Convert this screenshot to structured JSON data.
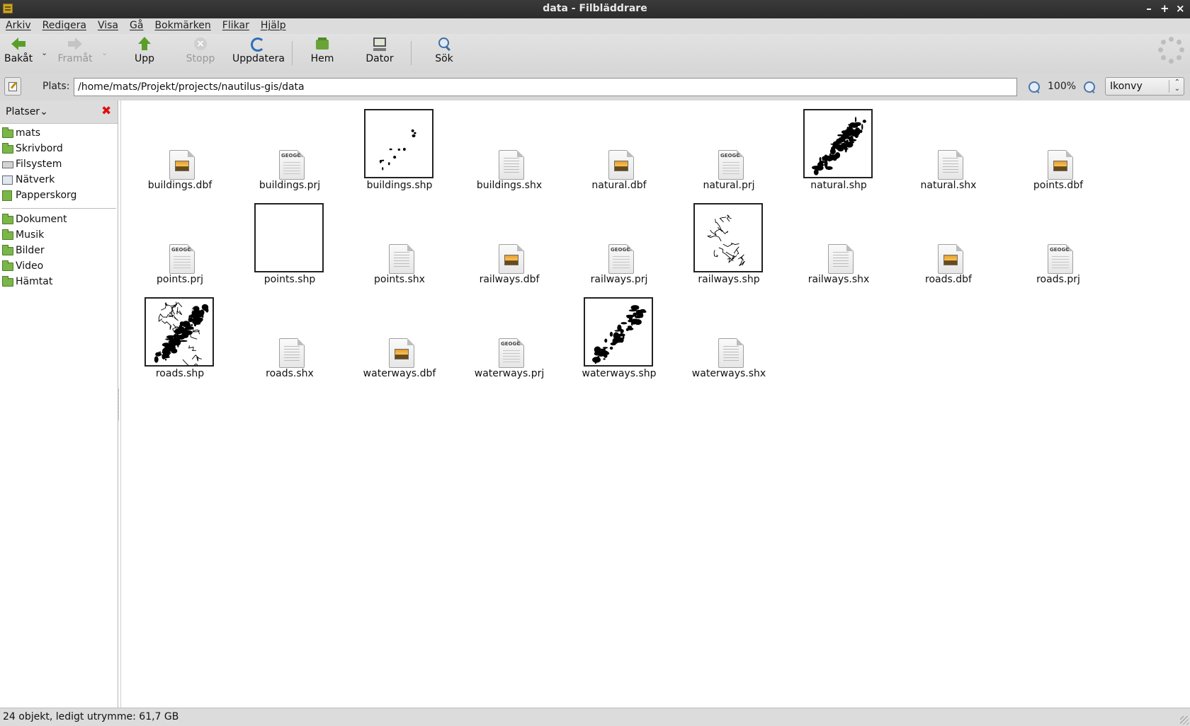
{
  "window": {
    "title": "data - Filbläddrare"
  },
  "menu": [
    "Arkiv",
    "Redigera",
    "Visa",
    "Gå",
    "Bokmärken",
    "Flikar",
    "Hjälp"
  ],
  "toolbar": {
    "back": "Bakåt",
    "forward": "Framåt",
    "up": "Upp",
    "stop": "Stopp",
    "reload": "Uppdatera",
    "home": "Hem",
    "computer": "Dator",
    "search": "Sök"
  },
  "location": {
    "label": "Plats:",
    "path": "/home/mats/Projekt/projects/nautilus-gis/data",
    "zoom": "100%",
    "view": "Ikonvy"
  },
  "sidebar": {
    "header": "Platser",
    "places": [
      {
        "label": "mats",
        "icon": "folder-icon"
      },
      {
        "label": "Skrivbord",
        "icon": "folder-icon"
      },
      {
        "label": "Filsystem",
        "icon": "drive-icon"
      },
      {
        "label": "Nätverk",
        "icon": "network-icon"
      },
      {
        "label": "Papperskorg",
        "icon": "trash-icon"
      }
    ],
    "bookmarks": [
      {
        "label": "Dokument",
        "icon": "folder-icon"
      },
      {
        "label": "Musik",
        "icon": "folder-icon"
      },
      {
        "label": "Bilder",
        "icon": "folder-icon"
      },
      {
        "label": "Video",
        "icon": "folder-icon"
      },
      {
        "label": "Hämtat",
        "icon": "folder-icon"
      }
    ]
  },
  "files": [
    {
      "name": "buildings.dbf",
      "type": "dbf"
    },
    {
      "name": "buildings.prj",
      "type": "prj"
    },
    {
      "name": "buildings.shp",
      "type": "shp"
    },
    {
      "name": "buildings.shx",
      "type": "shx"
    },
    {
      "name": "natural.dbf",
      "type": "dbf"
    },
    {
      "name": "natural.prj",
      "type": "prj"
    },
    {
      "name": "natural.shp",
      "type": "shp"
    },
    {
      "name": "natural.shx",
      "type": "shx"
    },
    {
      "name": "points.dbf",
      "type": "dbf"
    },
    {
      "name": "points.prj",
      "type": "prj"
    },
    {
      "name": "points.shp",
      "type": "shp"
    },
    {
      "name": "points.shx",
      "type": "shx"
    },
    {
      "name": "railways.dbf",
      "type": "dbf"
    },
    {
      "name": "railways.prj",
      "type": "prj"
    },
    {
      "name": "railways.shp",
      "type": "shp"
    },
    {
      "name": "railways.shx",
      "type": "shx"
    },
    {
      "name": "roads.dbf",
      "type": "dbf"
    },
    {
      "name": "roads.prj",
      "type": "prj"
    },
    {
      "name": "roads.shp",
      "type": "shp"
    },
    {
      "name": "roads.shx",
      "type": "shx"
    },
    {
      "name": "waterways.dbf",
      "type": "dbf"
    },
    {
      "name": "waterways.prj",
      "type": "prj"
    },
    {
      "name": "waterways.shp",
      "type": "shp"
    },
    {
      "name": "waterways.shx",
      "type": "shx"
    }
  ],
  "prj_badge": "GEOGC",
  "status": "24 objekt, ledigt utrymme: 61,7 GB"
}
